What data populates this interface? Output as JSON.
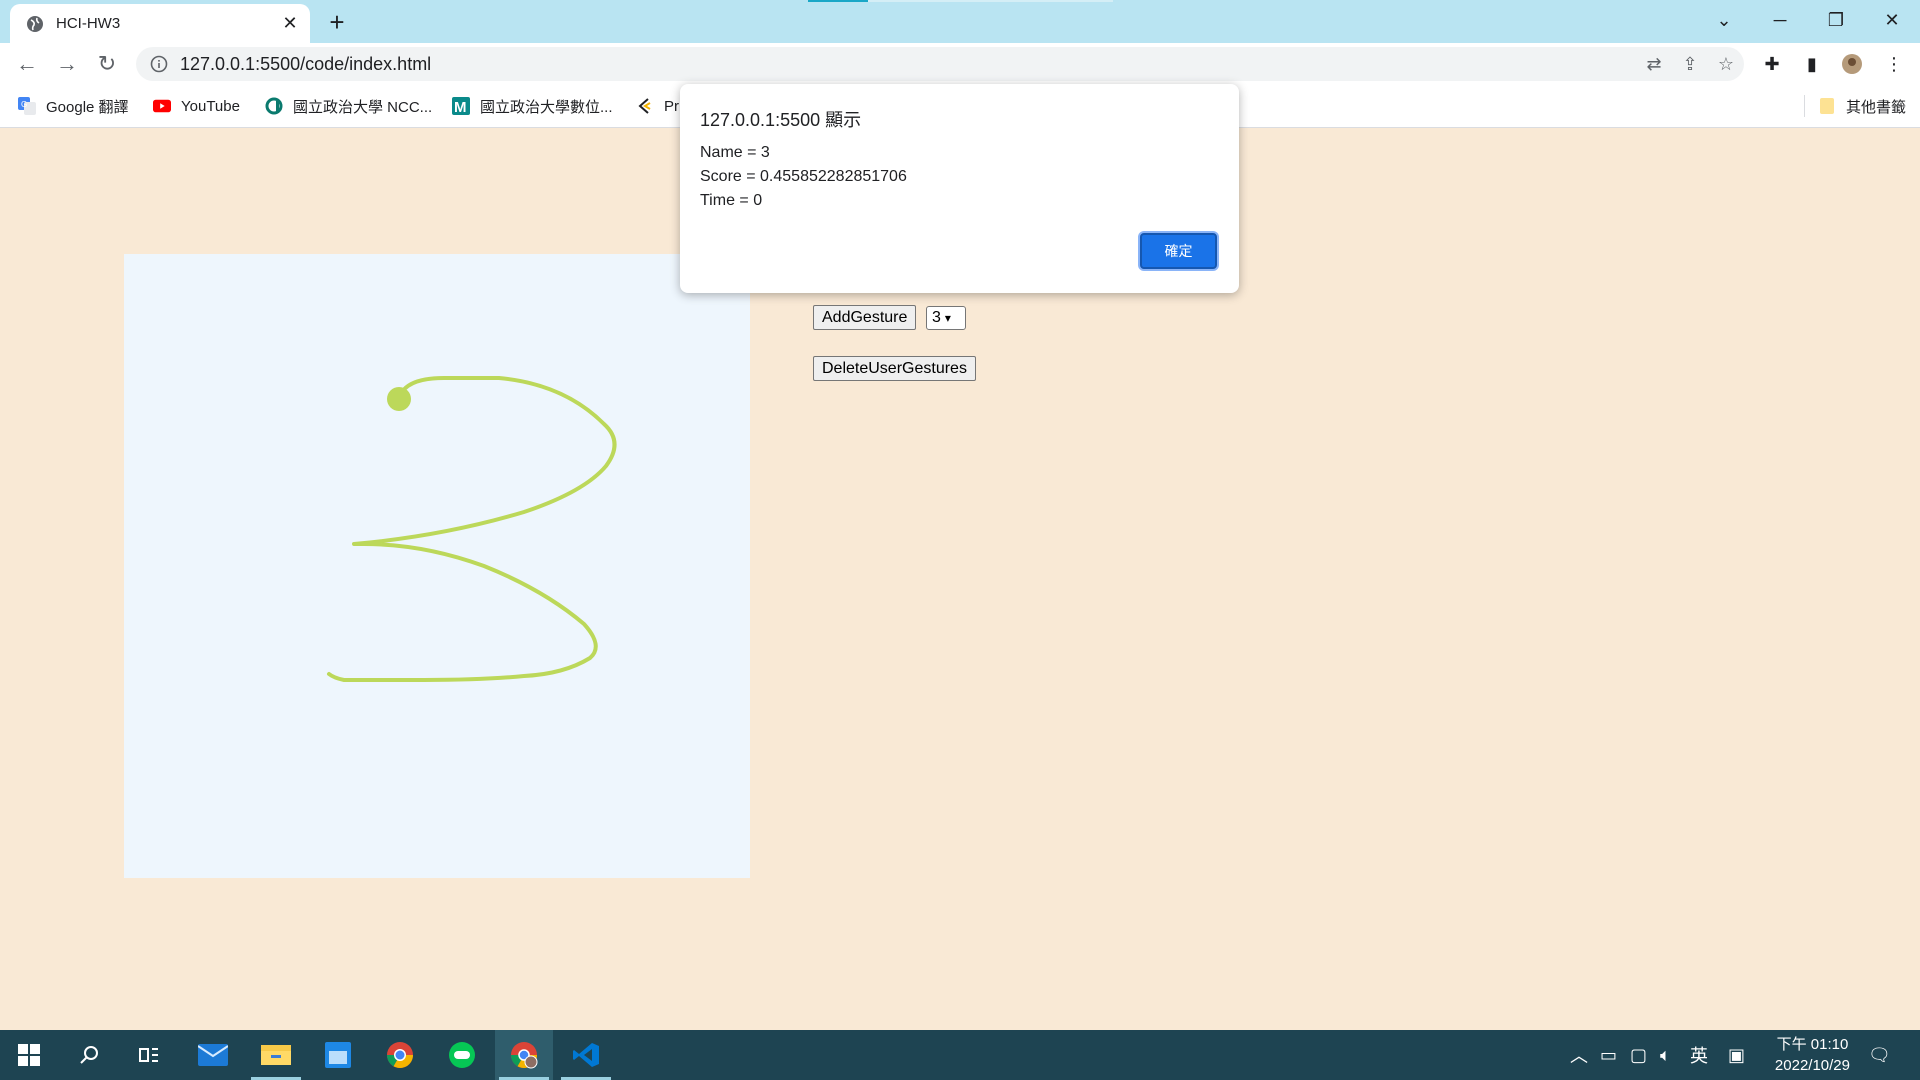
{
  "tab": {
    "title": "HCI-HW3"
  },
  "address_bar": {
    "url": "127.0.0.1:5500/code/index.html"
  },
  "bookmarks": [
    {
      "label": "Google 翻譯",
      "icon": "google-translate-icon"
    },
    {
      "label": "YouTube",
      "icon": "youtube-icon"
    },
    {
      "label": "國立政治大學 NCC...",
      "icon": "nccu-icon"
    },
    {
      "label": "國立政治大學數位...",
      "icon": "moodle-icon"
    },
    {
      "label": "Pr",
      "icon": "bookmark-icon"
    }
  ],
  "other_bookmarks": "其他書籤",
  "page": {
    "add_gesture_label": "AddGesture",
    "gesture_select_value": "3",
    "delete_gestures_label": "DeleteUserGestures",
    "stroke_color": "#bcd85a",
    "canvas_bg": "#eef6fd",
    "page_bg": "#f9e9d5"
  },
  "dialog": {
    "title": "127.0.0.1:5500 顯示",
    "lines": [
      "Name = 3",
      "Score = 0.455852282851706",
      "Time = 0"
    ],
    "ok_label": "確定"
  },
  "taskbar": {
    "apps": [
      "windows-start-icon",
      "search-icon",
      "task-view-icon",
      "mail-icon",
      "file-explorer-icon",
      "calendar-icon",
      "chrome-icon",
      "line-icon",
      "chrome-profile-icon",
      "vscode-icon"
    ],
    "ime": "英",
    "time": "下午 01:10",
    "date": "2022/10/29"
  }
}
